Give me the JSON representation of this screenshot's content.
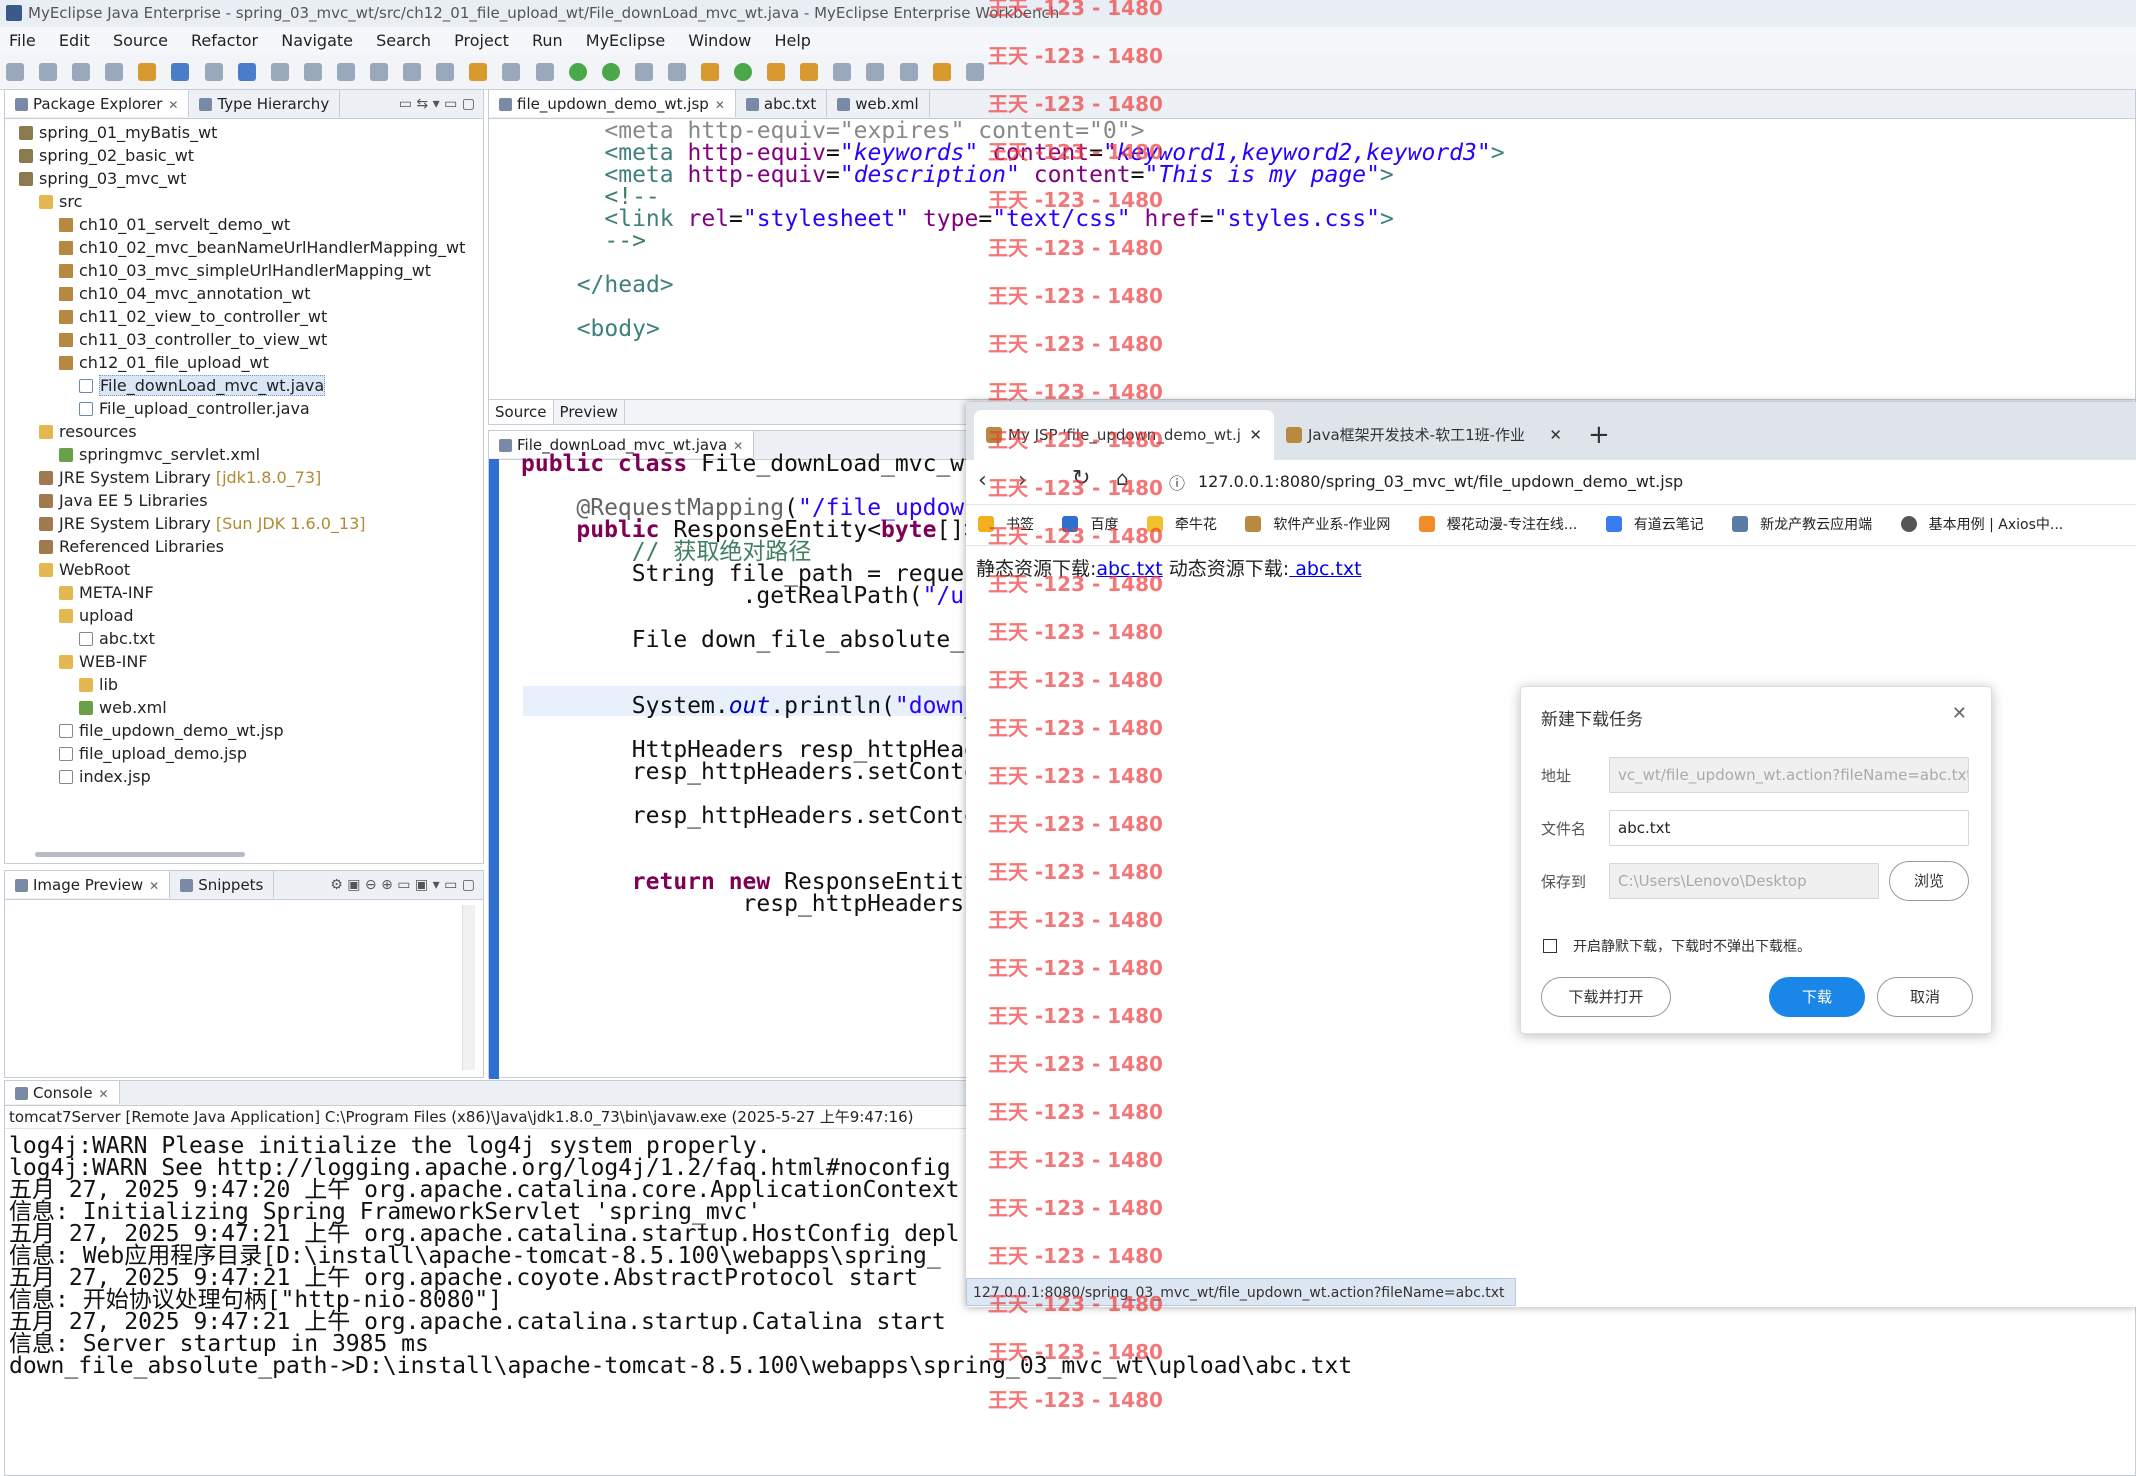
{
  "window": {
    "title": "MyEclipse Java Enterprise - spring_03_mvc_wt/src/ch12_01_file_upload_wt/File_downLoad_mvc_wt.java - MyEclipse Enterprise Workbench"
  },
  "menu": [
    "File",
    "Edit",
    "Source",
    "Refactor",
    "Navigate",
    "Search",
    "Project",
    "Run",
    "MyEclipse",
    "Window",
    "Help"
  ],
  "explorer": {
    "tabs": {
      "package_explorer": "Package Explorer",
      "type_hierarchy": "Type Hierarchy"
    },
    "items": [
      {
        "label": "spring_01_myBatis_wt",
        "indent": 0,
        "icon": "project"
      },
      {
        "label": "spring_02_basic_wt",
        "indent": 0,
        "icon": "project"
      },
      {
        "label": "spring_03_mvc_wt",
        "indent": 0,
        "icon": "project"
      },
      {
        "label": "src",
        "indent": 1,
        "icon": "folder"
      },
      {
        "label": "ch10_01_servelt_demo_wt",
        "indent": 2,
        "icon": "package"
      },
      {
        "label": "ch10_02_mvc_beanNameUrlHandlerMapping_wt",
        "indent": 2,
        "icon": "package"
      },
      {
        "label": "ch10_03_mvc_simpleUrlHandlerMapping_wt",
        "indent": 2,
        "icon": "package"
      },
      {
        "label": "ch10_04_mvc_annotation_wt",
        "indent": 2,
        "icon": "package"
      },
      {
        "label": "ch11_02_view_to_controller_wt",
        "indent": 2,
        "icon": "package"
      },
      {
        "label": "ch11_03_controller_to_view_wt",
        "indent": 2,
        "icon": "package"
      },
      {
        "label": "ch12_01_file_upload_wt",
        "indent": 2,
        "icon": "package"
      },
      {
        "label": "File_downLoad_mvc_wt.java",
        "indent": 3,
        "icon": "java",
        "selected": true
      },
      {
        "label": "File_upload_controller.java",
        "indent": 3,
        "icon": "java"
      },
      {
        "label": "resources",
        "indent": 1,
        "icon": "folder"
      },
      {
        "label": "springmvc_servlet.xml",
        "indent": 2,
        "icon": "xml"
      },
      {
        "label": "JRE System Library",
        "note": "[jdk1.8.0_73]",
        "indent": 1,
        "icon": "lib"
      },
      {
        "label": "Java EE 5 Libraries",
        "indent": 1,
        "icon": "lib"
      },
      {
        "label": "JRE System Library",
        "note": "[Sun JDK 1.6.0_13]",
        "indent": 1,
        "icon": "lib"
      },
      {
        "label": "Referenced Libraries",
        "indent": 1,
        "icon": "lib"
      },
      {
        "label": "WebRoot",
        "indent": 1,
        "icon": "folder"
      },
      {
        "label": "META-INF",
        "indent": 2,
        "icon": "folder"
      },
      {
        "label": "upload",
        "indent": 2,
        "icon": "folder"
      },
      {
        "label": "abc.txt",
        "indent": 3,
        "icon": "file"
      },
      {
        "label": "WEB-INF",
        "indent": 2,
        "icon": "folder"
      },
      {
        "label": "lib",
        "indent": 3,
        "icon": "folder"
      },
      {
        "label": "web.xml",
        "indent": 3,
        "icon": "xml"
      },
      {
        "label": "file_updown_demo_wt.jsp",
        "indent": 2,
        "icon": "file"
      },
      {
        "label": "file_upload_demo.jsp",
        "indent": 2,
        "icon": "file"
      },
      {
        "label": "index.jsp",
        "indent": 2,
        "icon": "file"
      }
    ]
  },
  "preview": {
    "tabs": {
      "image_preview": "Image Preview",
      "snippets": "Snippets"
    }
  },
  "editor_top": {
    "tabs": [
      "file_updown_demo_wt.jsp",
      "abc.txt",
      "web.xml"
    ],
    "bottom_tabs": {
      "source": "Source",
      "preview": "Preview"
    }
  },
  "editor_bottom": {
    "tab": "File_downLoad_mvc_wt.java"
  },
  "console": {
    "tab": "Console",
    "header": "tomcat7Server [Remote Java Application] C:\\Program Files (x86)\\Java\\jdk1.8.0_73\\bin\\javaw.exe (2025-5-27 上午9:47:16)",
    "lines": [
      "log4j:WARN Please initialize the log4j system properly.",
      "log4j:WARN See http://logging.apache.org/log4j/1.2/faq.html#noconfig",
      "五月 27, 2025 9:47:20 上午 org.apache.catalina.core.ApplicationContext",
      "信息: Initializing Spring FrameworkServlet 'spring_mvc'",
      "五月 27, 2025 9:47:21 上午 org.apache.catalina.startup.HostConfig depl",
      "信息: Web应用程序目录[D:\\install\\apache-tomcat-8.5.100\\webapps\\spring_",
      "五月 27, 2025 9:47:21 上午 org.apache.coyote.AbstractProtocol start",
      "信息: 开始协议处理句柄[\"http-nio-8080\"]",
      "五月 27, 2025 9:47:21 上午 org.apache.catalina.startup.Catalina start",
      "信息: Server startup in 3985 ms",
      "down_file_absolute_path->D:\\install\\apache-tomcat-8.5.100\\webapps\\spring_03_mvc_wt\\upload\\abc.txt"
    ]
  },
  "browser": {
    "tabs": [
      "My JSP 'file_updown_demo_wt.j",
      "Java框架开发技术-软工1班-作业"
    ],
    "url": "127.0.0.1:8080/spring_03_mvc_wt/file_updown_demo_wt.jsp",
    "bookmarks": [
      "书签",
      "百度",
      "牵牛花",
      "软件产业系-作业网",
      "樱花动漫-专注在线...",
      "有道云笔记",
      "新龙产教云应用端",
      "基本用例 | Axios中..."
    ],
    "page": {
      "static_label": "静态资源下载:",
      "static_link": "abc.txt",
      "dynamic_label": "动态资源下载:",
      "dynamic_link": " abc.txt"
    },
    "status_url": "127.0.0.1:8080/spring_03_mvc_wt/file_updown_wt.action?fileName=abc.txt"
  },
  "download_dialog": {
    "title": "新建下载任务",
    "address_label": "地址",
    "address_value": "vc_wt/file_updown_wt.action?fileName=abc.txt",
    "filename_label": "文件名",
    "filename_value": "abc.txt",
    "saveto_label": "保存到",
    "saveto_value": "C:\\Users\\Lenovo\\Desktop",
    "browse_button": "浏览",
    "silent_label": "开启静默下载，下载时不弹出下载框。",
    "download_open_button": "下载并打开",
    "download_button": "下载",
    "cancel_button": "取消"
  },
  "watermark": "王天 -123 - 1480",
  "colors": {
    "accent": "#1a86e8",
    "watermark": "#f03c3c",
    "link": "#0000ee"
  }
}
